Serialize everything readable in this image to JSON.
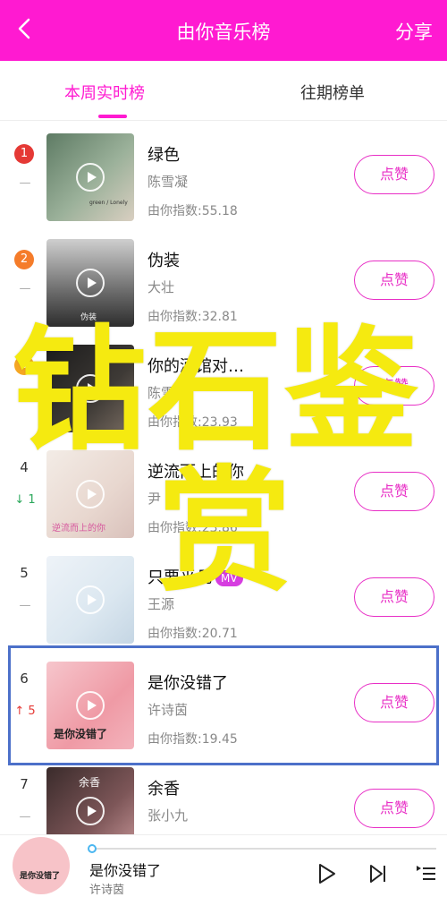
{
  "header": {
    "title": "由你音乐榜",
    "share_label": "分享"
  },
  "tabs": [
    {
      "label": "本周实时榜",
      "active": true
    },
    {
      "label": "往期榜单",
      "active": false
    }
  ],
  "songs": [
    {
      "rank": "1",
      "trend": "—",
      "title": "绿色",
      "artist": "陈雪凝",
      "index": "由你指数:55.18",
      "like": "点赞",
      "cover_text": "green / Lonely"
    },
    {
      "rank": "2",
      "trend": "—",
      "title": "伪装",
      "artist": "大壮",
      "index": "由你指数:32.81",
      "like": "点赞",
      "cover_text": "伪装"
    },
    {
      "rank": "3",
      "trend": "↑",
      "title": "你的酒馆对…",
      "artist": "陈雪凝",
      "index": "由你指数:23.93",
      "like": "点赞"
    },
    {
      "rank": "4",
      "trend": "↓ 1",
      "title": "逆流而上的你",
      "artist": "尹",
      "index": "由你指数:23.86",
      "like": "点赞",
      "cover_text": "逆流而上的你"
    },
    {
      "rank": "5",
      "trend": "—",
      "title": "只要平凡",
      "mv": "MV",
      "artist": "王源",
      "index": "由你指数:20.71",
      "like": "点赞"
    },
    {
      "rank": "6",
      "trend": "↑ 5",
      "title": "是你没错了",
      "artist": "许诗茵",
      "index": "由你指数:19.45",
      "like": "点赞",
      "cover_text": "是你没错了"
    },
    {
      "rank": "7",
      "trend": "—",
      "title": "余香",
      "artist": "张小九",
      "index": "",
      "like": "点赞",
      "cover_text": "余香"
    }
  ],
  "player": {
    "title": "是你没错了",
    "artist": "许诗茵",
    "cover_text": "是你没错了"
  },
  "overlay": {
    "line1": "钻石鉴",
    "line2": "赏"
  },
  "colors": {
    "brand": "#ff1ad1",
    "highlight": "#4c70c9",
    "overlay": "#f5ea10"
  }
}
